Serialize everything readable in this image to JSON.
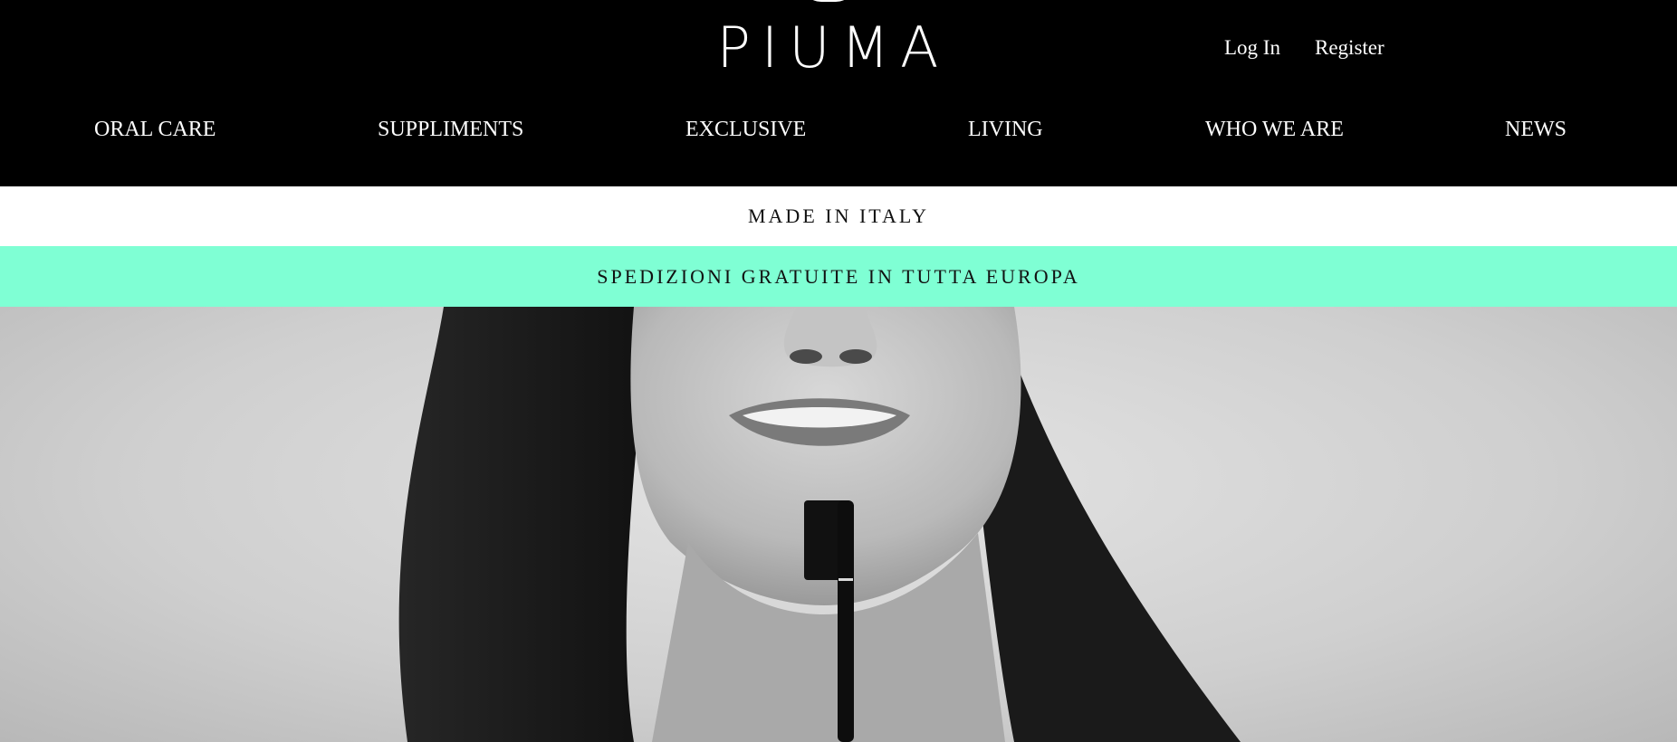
{
  "brand": {
    "logo_text": "PIUMA"
  },
  "account": {
    "login_label": "Log In",
    "register_label": "Register"
  },
  "nav": {
    "items": [
      {
        "label": "ORAL CARE"
      },
      {
        "label": "SUPPLIMENTS"
      },
      {
        "label": "EXCLUSIVE"
      },
      {
        "label": "LIVING"
      },
      {
        "label": "WHO WE ARE"
      },
      {
        "label": "NEWS"
      }
    ]
  },
  "banners": {
    "made_in": "MADE IN ITALY",
    "shipping": "SPEDIZIONI GRATUITE IN TUTTA EUROPA"
  },
  "colors": {
    "header_bg": "#000000",
    "accent_band": "#7fffd4",
    "text_light": "#ffffff"
  }
}
